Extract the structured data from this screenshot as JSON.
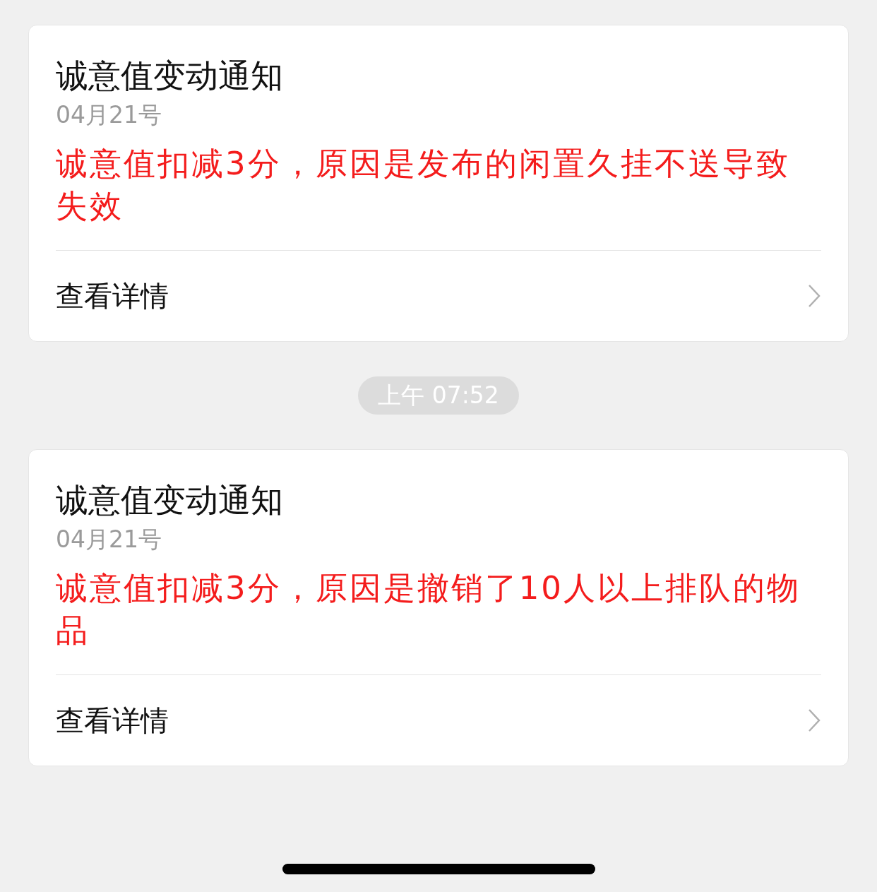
{
  "messages": [
    {
      "kind": "card",
      "title": "诚意值变动通知",
      "date": "04月21号",
      "body": "诚意值扣减3分，原因是发布的闲置久挂不送导致失效",
      "link": "查看详情"
    },
    {
      "kind": "time",
      "time": "上午 07:52"
    },
    {
      "kind": "card",
      "title": "诚意值变动通知",
      "date": "04月21号",
      "body": "诚意值扣减3分，原因是撤销了10人以上排队的物品",
      "link": "查看详情"
    }
  ]
}
